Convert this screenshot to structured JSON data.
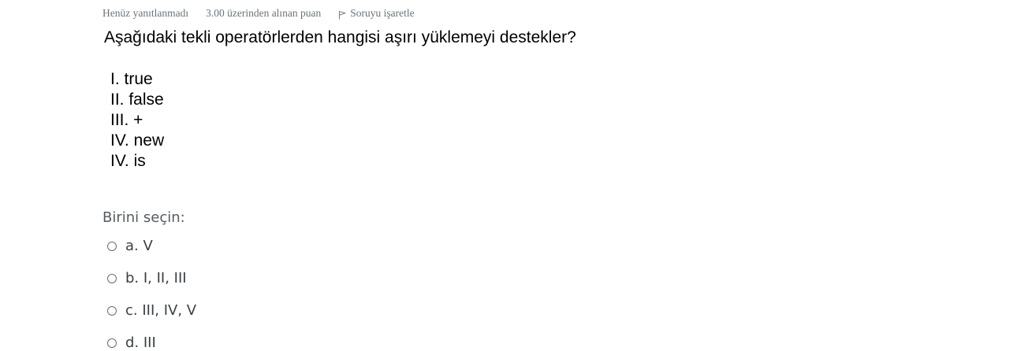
{
  "question_info": {
    "status": "Henüz yanıtlanmadı",
    "grade": "3.00 üzerinden alınan puan",
    "flag_label": "Soruyu işaretle",
    "flag_icon": "flag-icon"
  },
  "question": {
    "text": "Aşağıdaki tekli operatörlerden hangisi aşırı yüklemeyi destekler?",
    "statements": [
      "I. true",
      "II. false",
      "III. +",
      "IV. new",
      "IV. is"
    ]
  },
  "answer": {
    "prompt": "Birini seçin:",
    "options": [
      "a. V",
      "b. I, II, III",
      "c. III, IV, V",
      "d. III"
    ]
  },
  "colors": {
    "meta_text": "#6a737b",
    "prompt_text": "#555b61",
    "option_text": "#3a3f45"
  }
}
